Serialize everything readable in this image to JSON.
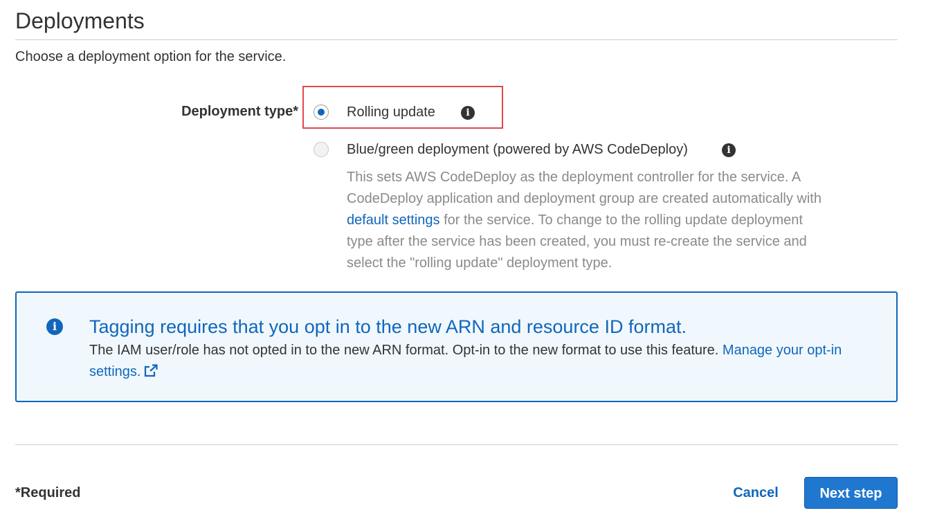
{
  "section": {
    "title": "Deployments",
    "description": "Choose a deployment option for the service."
  },
  "deployment_type": {
    "label": "Deployment type*",
    "options": [
      {
        "label": "Rolling update",
        "selected": true,
        "info_icon": "info-icon"
      },
      {
        "label": "Blue/green deployment (powered by AWS CodeDeploy)",
        "selected": false,
        "info_icon": "info-icon"
      }
    ],
    "help_text_before_link": "This sets AWS CodeDeploy as the deployment controller for the service. A CodeDeploy application and deployment group are created automatically with ",
    "help_link": "default settings",
    "help_text_after_link": " for the service. To change to the rolling update deployment type after the service has been created, you must re-create the service and select the \"rolling update\" deployment type."
  },
  "alert": {
    "icon": "info-icon",
    "title": "Tagging requires that you opt in to the new ARN and resource ID format.",
    "body": "The IAM user/role has not opted in to the new ARN format. Opt-in to the new format to use this feature. ",
    "link": "Manage your opt-in settings.",
    "link_icon": "external-link-icon"
  },
  "footer": {
    "required_note": "*Required",
    "cancel_label": "Cancel",
    "next_label": "Next step"
  },
  "colors": {
    "accent": "#1166bb",
    "highlight_border": "#e1474c",
    "alert_background": "#f0f8fd",
    "muted_text": "#8a8a8a"
  }
}
